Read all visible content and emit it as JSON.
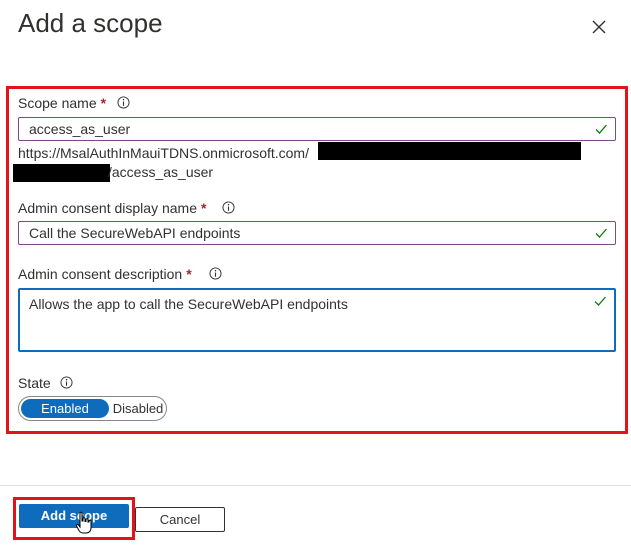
{
  "panel": {
    "title": "Add a scope"
  },
  "scope_name": {
    "label": "Scope name",
    "required_mark": "*",
    "value": "access_as_user",
    "uri_prefix": "https://MsalAuthInMauiTDNS.onmicrosoft.com/",
    "uri_suffix": "/access_as_user"
  },
  "admin_consent_display_name": {
    "label": "Admin consent display name",
    "required_mark": "*",
    "value": "Call the SecureWebAPI endpoints"
  },
  "admin_consent_description": {
    "label": "Admin consent description",
    "required_mark": "*",
    "value": "Allows the app to call the SecureWebAPI endpoints"
  },
  "state": {
    "label": "State",
    "options": [
      "Enabled",
      "Disabled"
    ],
    "selected": "Enabled"
  },
  "footer": {
    "add_label": "Add scope",
    "cancel_label": "Cancel"
  },
  "colors": {
    "accent": "#0f6cbd",
    "highlight": "#e3131b",
    "valid_check": "#107c10"
  }
}
